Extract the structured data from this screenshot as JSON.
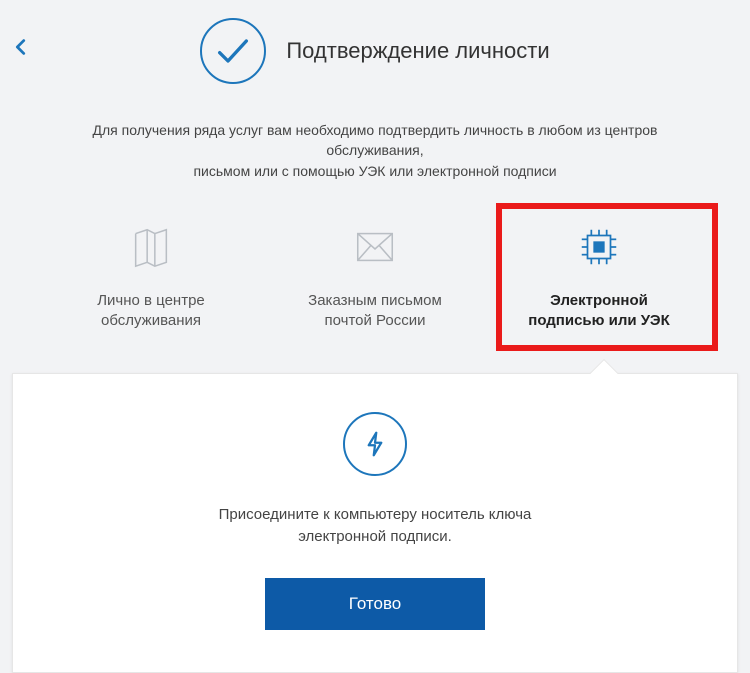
{
  "header": {
    "title": "Подтверждение личности"
  },
  "description": {
    "line1": "Для получения ряда услуг вам необходимо подтвердить личность в любом из центров обслуживания,",
    "line2": "письмом или с помощью УЭК или электронной подписи"
  },
  "options": [
    {
      "label_line1": "Лично в центре",
      "label_line2": "обслуживания"
    },
    {
      "label_line1": "Заказным письмом",
      "label_line2": "почтой России"
    },
    {
      "label_line1": "Электронной",
      "label_line2": "подписью или УЭК"
    }
  ],
  "panel": {
    "text_line1": "Присоедините к компьютеру носитель ключа",
    "text_line2": "электронной подписи.",
    "button": "Готово"
  },
  "colors": {
    "accent": "#1d76bb",
    "button_bg": "#0d5aa7",
    "highlight": "#ea1a1a"
  }
}
